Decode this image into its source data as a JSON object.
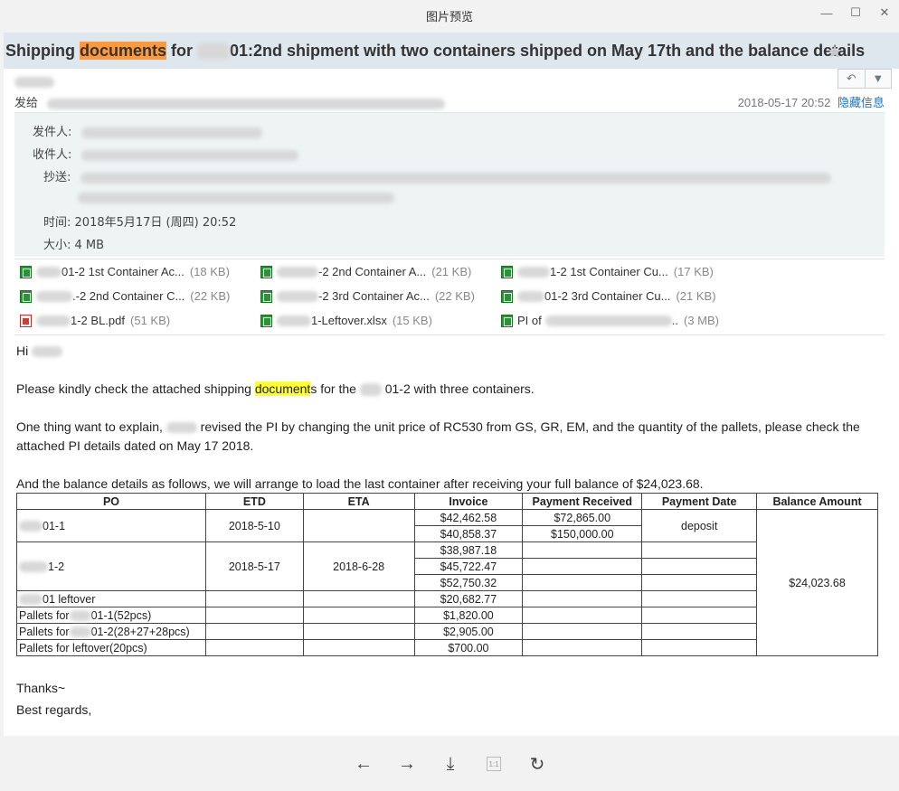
{
  "window": {
    "title": "图片预览",
    "controls": [
      "—",
      "☐",
      "✕"
    ]
  },
  "email": {
    "subject_prefix": "Shipping ",
    "subject_highlight": "documents",
    "subject_mid": " for ",
    "subject_suffix": "01:2nd shipment with two containers shipped on May 17th and the balance details",
    "to_label": "发给",
    "datetime": "2018-05-17 20:52",
    "hide_info": "隐藏信息",
    "from_label": "发件人:",
    "recipient_label": "收件人:",
    "cc_label": "抄送:",
    "time_label": "时间:",
    "time_value": "2018年5月17日 (周四) 20:52",
    "size_label": "大小:",
    "size_value": "4 MB"
  },
  "attachments": [
    {
      "name": "01-2 1st Container Ac...",
      "size": "(18 KB)",
      "icon": "excel-icon"
    },
    {
      "name": "-2 2nd Container A...",
      "size": "(21 KB)",
      "icon": "excel-icon"
    },
    {
      "name": "1-2 1st Container Cu...",
      "size": "(17 KB)",
      "icon": "excel-icon"
    },
    {
      "name": ".-2 2nd Container C...",
      "size": "(22 KB)",
      "icon": "excel-icon"
    },
    {
      "name": "-2 3rd Container Ac...",
      "size": "(22 KB)",
      "icon": "excel-icon"
    },
    {
      "name": "01-2 3rd Container Cu...",
      "size": "(21 KB)",
      "icon": "excel-icon"
    },
    {
      "name": "1-2 BL.pdf",
      "size": "(51 KB)",
      "icon": "pdf-icon"
    },
    {
      "name": "1-Leftover.xlsx",
      "size": "(15 KB)",
      "icon": "excel-icon"
    },
    {
      "name": "PI of",
      "name_suffix": "..",
      "size": "(3 MB)",
      "icon": "excel-icon"
    }
  ],
  "body": {
    "greeting": "Hi",
    "p1_before": "Please kindly check the attached shipping ",
    "p1_highlight": "document",
    "p1_after": "s for the",
    "p1_end": "01-2 with three containers.",
    "p2_a": "One thing want to explain,",
    "p2_b": "revised the PI by changing the unit price of RC530 from GS, GR, EM, and the quantity of the pallets, please check the",
    "p2_c": "attached PI details dated on May 17 2018.",
    "p3": "And the balance details as follows, we will arrange to load the last container after receiving your full balance of $24,023.68.",
    "thanks": "Thanks~",
    "regards": "Best regards,"
  },
  "table": {
    "headers": [
      "PO",
      "ETD",
      "ETA",
      "Invoice",
      "Payment Received",
      "Payment Date",
      "Balance Amount"
    ],
    "po_1": "01-1",
    "po_2": "1-2",
    "po_3": "01 leftover",
    "pallets_1_a": "Pallets for",
    "pallets_1_b": "01-1(52pcs)",
    "pallets_2_a": "Pallets for",
    "pallets_2_b": "01-2(28+27+28pcs)",
    "pallets_3": "Pallets for leftover(20pcs)",
    "etd_1": "2018-5-10",
    "etd_2": "2018-5-17",
    "eta_2": "2018-6-28",
    "inv": [
      "$42,462.58",
      "$40,858.37",
      "$38,987.18",
      "$45,722.47",
      "$52,750.32",
      "$20,682.77",
      "$1,820.00",
      "$2,905.00",
      "$700.00"
    ],
    "paid_1": "$72,865.00",
    "paid_2": "$150,000.00",
    "pay_date": "deposit",
    "balance": "$24,023.68"
  },
  "toolbar": {
    "prev": "←",
    "next": "→",
    "download": "⤓",
    "actual_size": "1:1",
    "rotate": "↻"
  }
}
